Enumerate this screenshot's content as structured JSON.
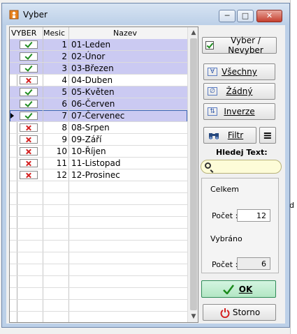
{
  "window": {
    "title": "Vyber",
    "min_label": "─",
    "max_label": "□",
    "close_label": "✕"
  },
  "grid": {
    "headers": {
      "vyber": "VYBER",
      "mesic": "Mesic",
      "nazev": "Nazev"
    },
    "rows": [
      {
        "num": "1",
        "name": "01-Leden",
        "checked": true
      },
      {
        "num": "2",
        "name": "02-Únor",
        "checked": true
      },
      {
        "num": "3",
        "name": "03-Březen",
        "checked": true
      },
      {
        "num": "4",
        "name": "04-Duben",
        "checked": false
      },
      {
        "num": "5",
        "name": "05-Květen",
        "checked": true
      },
      {
        "num": "6",
        "name": "06-Červen",
        "checked": true
      },
      {
        "num": "7",
        "name": "07-Červenec",
        "checked": true
      },
      {
        "num": "8",
        "name": "08-Srpen",
        "checked": false
      },
      {
        "num": "9",
        "name": "09-Září",
        "checked": false
      },
      {
        "num": "10",
        "name": "10-Říjen",
        "checked": false
      },
      {
        "num": "11",
        "name": "11-Listopad",
        "checked": false
      },
      {
        "num": "12",
        "name": "12-Prosinec",
        "checked": false
      }
    ],
    "current_row": 6
  },
  "buttons": {
    "vyber_nevyber": "Vyber / Nevyber",
    "vsechny": "Všechny",
    "zadny": "Žádný",
    "inverze": "Inverze",
    "filtr": "Filtr",
    "menu": "≡",
    "ok": "OK",
    "storno": "Storno"
  },
  "search": {
    "label": "Hledej Text:",
    "value": ""
  },
  "summary": {
    "celkem_label": "Celkem",
    "pocet_label": "Počet :",
    "celkem_value": "12",
    "vybrano_label": "Vybráno",
    "vybrano_value": "6"
  },
  "background": {
    "text1": "d"
  }
}
